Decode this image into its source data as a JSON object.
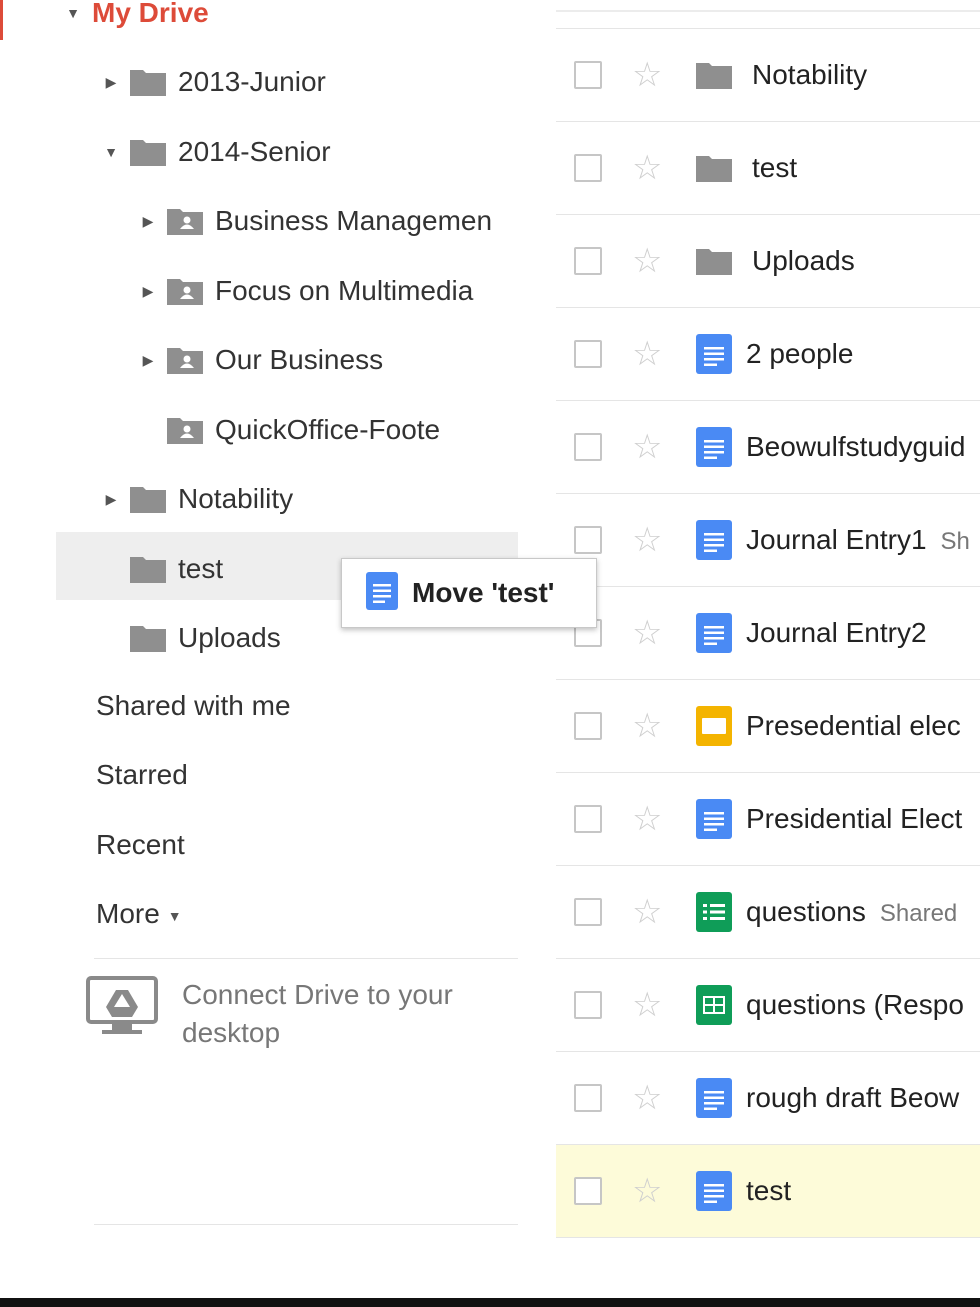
{
  "sidebar": {
    "my_drive": "My Drive",
    "tree": [
      {
        "label": "2013-Junior",
        "caret": "right",
        "kind": "folder"
      },
      {
        "label": "2014-Senior",
        "caret": "down",
        "kind": "folder"
      },
      {
        "label": "Business Managemen",
        "caret": "right",
        "kind": "shared-folder"
      },
      {
        "label": "Focus on Multimedia",
        "caret": "right",
        "kind": "shared-folder"
      },
      {
        "label": "Our Business",
        "caret": "right",
        "kind": "shared-folder"
      },
      {
        "label": "QuickOffice-Foote",
        "caret": "none",
        "kind": "shared-folder"
      },
      {
        "label": "Notability",
        "caret": "right",
        "kind": "folder"
      },
      {
        "label": "test",
        "caret": "none",
        "kind": "folder",
        "selected": true
      },
      {
        "label": "Uploads",
        "caret": "none",
        "kind": "folder"
      }
    ],
    "nav": {
      "shared_with_me": "Shared with me",
      "starred": "Starred",
      "recent": "Recent",
      "more": "More"
    },
    "connect_drive": "Connect Drive to your desktop"
  },
  "drag_tooltip": {
    "label": "Move 'test'",
    "icon": "docs-icon"
  },
  "files": [
    {
      "name": "Notability",
      "type": "folder",
      "shared": ""
    },
    {
      "name": "test",
      "type": "folder",
      "shared": ""
    },
    {
      "name": "Uploads",
      "type": "folder",
      "shared": ""
    },
    {
      "name": "2 people",
      "type": "doc",
      "shared": ""
    },
    {
      "name": "Beowulfstudyguid",
      "type": "doc",
      "shared": ""
    },
    {
      "name": "Journal Entry1",
      "type": "doc",
      "shared": "Sh"
    },
    {
      "name": "Journal Entry2",
      "type": "doc",
      "shared": ""
    },
    {
      "name": "Presedential elec",
      "type": "slides",
      "shared": ""
    },
    {
      "name": "Presidential Elect",
      "type": "doc",
      "shared": ""
    },
    {
      "name": "questions",
      "type": "form",
      "shared": "Shared"
    },
    {
      "name": "questions (Respo",
      "type": "sheet",
      "shared": ""
    },
    {
      "name": "rough draft Beow",
      "type": "doc",
      "shared": ""
    },
    {
      "name": "test",
      "type": "doc",
      "shared": "",
      "highlighted": true
    }
  ],
  "colors": {
    "accent_red": "#dd4b39",
    "doc_blue": "#4a8af4",
    "slides_yellow": "#f4b400",
    "sheet_green": "#0f9d58",
    "folder_gray": "#8f8f8f",
    "highlight_row": "#fdfbd9"
  }
}
